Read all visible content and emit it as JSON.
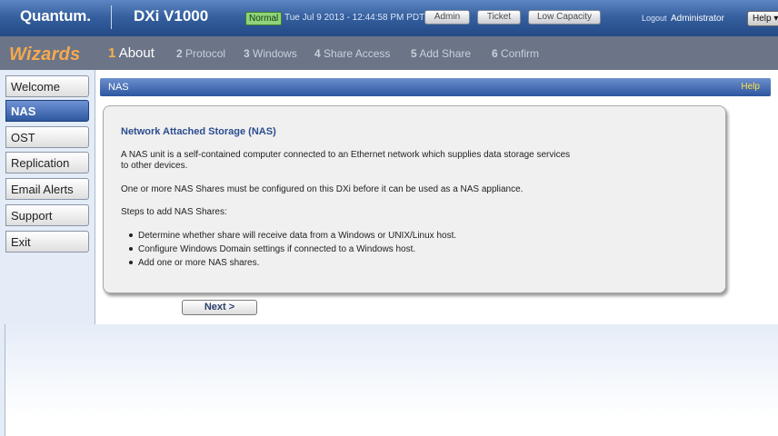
{
  "header": {
    "logo": "Quantum.",
    "product": "DXi V1000",
    "status": "Normal",
    "datetime": "Tue Jul 9 2013 - 12:44:58 PM PDT",
    "admin": "Admin",
    "ticket": "Ticket",
    "capacity": "Low Capacity",
    "logout": "Logout",
    "user": "Administrator",
    "help": "Help"
  },
  "wizard": {
    "title": "Wizards",
    "steps": [
      {
        "num": "1",
        "label": "About"
      },
      {
        "num": "2",
        "label": "Protocol"
      },
      {
        "num": "3",
        "label": "Windows"
      },
      {
        "num": "4",
        "label": "Share Access"
      },
      {
        "num": "5",
        "label": "Add Share"
      },
      {
        "num": "6",
        "label": "Confirm"
      }
    ]
  },
  "sidebar": {
    "items": [
      {
        "label": "Welcome"
      },
      {
        "label": "NAS"
      },
      {
        "label": "OST"
      },
      {
        "label": "Replication"
      },
      {
        "label": "Email Alerts"
      },
      {
        "label": "Support"
      },
      {
        "label": "Exit"
      }
    ]
  },
  "main": {
    "section_title": "NAS",
    "help": "Help",
    "panel": {
      "title": "Network Attached Storage (NAS)",
      "para1_line1": "A NAS unit is a self-contained computer connected to an Ethernet network which supplies data storage services",
      "para1_line2": "to other devices.",
      "para2": "One or more NAS Shares must be configured on this DXi before it can be used as a NAS appliance.",
      "para3": "Steps to add NAS Shares:",
      "bullets": [
        "Determine whether share will receive data from a Windows or UNIX/Linux host.",
        "Configure Windows Domain settings if connected to a Windows host.",
        "Add one or more NAS shares."
      ]
    },
    "next": "Next >"
  },
  "colors": {
    "header_blue": "#36609f",
    "wizard_gray": "#6c7587",
    "wizards_orange": "#f7a94d",
    "status_green": "#8fd27a",
    "help_yellow": "#ffe23c"
  }
}
